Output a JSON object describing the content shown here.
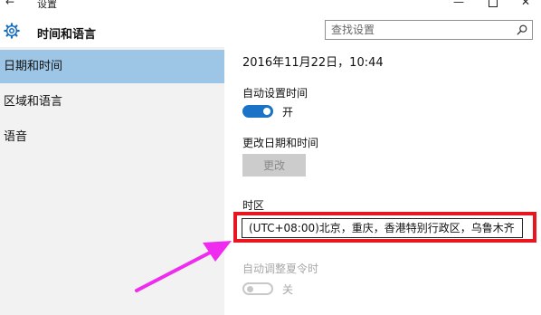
{
  "window": {
    "back_glyph": "←",
    "title": "设置",
    "minimize_glyph": "—",
    "close_glyph": "✕"
  },
  "header": {
    "icon": "gear-icon",
    "title": "时间和语言",
    "search_placeholder": "查找设置",
    "search_icon": "search-icon"
  },
  "sidebar": {
    "items": [
      {
        "label": "日期和时间",
        "active": true
      },
      {
        "label": "区域和语言",
        "active": false
      },
      {
        "label": "语音",
        "active": false
      }
    ]
  },
  "content": {
    "current_datetime": "2016年11月22日，10:44",
    "auto_time": {
      "label": "自动设置时间",
      "state": "开",
      "on": true
    },
    "change_datetime": {
      "label": "更改日期和时间",
      "button_label": "更改",
      "enabled": false
    },
    "timezone": {
      "label": "时区",
      "value": "(UTC+08:00)北京，重庆，香港特别行政区，乌鲁木齐"
    },
    "auto_dst": {
      "label": "自动调整夏令时",
      "state": "关",
      "on": false,
      "enabled": false
    }
  },
  "colors": {
    "sidebar_bg": "#f2f2f2",
    "active_item_bg": "#9dc6e6",
    "toggle_on": "#1a73c6",
    "highlight_box": "#e8171f",
    "annotation_arrow": "#ee2bef"
  }
}
